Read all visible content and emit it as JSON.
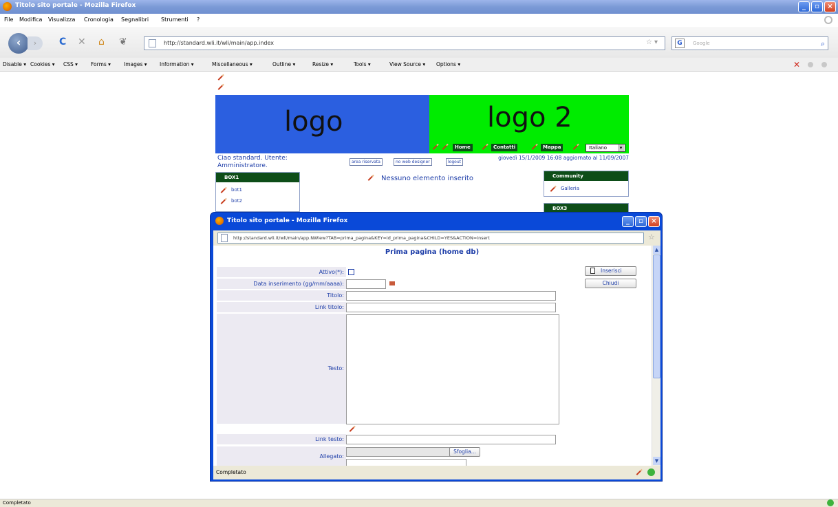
{
  "browser": {
    "window_title": "Titolo sito portale - Mozilla Firefox",
    "menu": [
      "File",
      "Modifica",
      "Visualizza",
      "Cronologia",
      "Segnalibri",
      "Strumenti",
      "?"
    ],
    "url": "http://standard.wli.it/wli/main/app.index",
    "search_placeholder": "Google",
    "search_engine_icon": "G",
    "devtools": [
      "Disable ▾",
      "Cookies ▾",
      "CSS ▾",
      "Forms ▾",
      "Images ▾",
      "Information ▾",
      "Miscellaneous ▾",
      "Outline ▾",
      "Resize ▾",
      "Tools ▾",
      "View Source ▾",
      "Options ▾"
    ],
    "status": "Completato"
  },
  "page": {
    "logo1": "logo",
    "logo2": "logo 2",
    "nav": [
      "Home",
      "Contatti",
      "Mappa"
    ],
    "language": "Italiano",
    "greeting": "Ciao standard. Utente: Amministratore.",
    "buttons": [
      "area riservata",
      "no web designer",
      "logout"
    ],
    "date": "giovedì 15/1/2009 16:08 aggiornato al 11/09/2007",
    "empty_msg": "Nessuno elemento inserito",
    "box1": {
      "title": "BOX1",
      "items": [
        "bot1",
        "bot2"
      ]
    },
    "community": {
      "title": "Community",
      "items": [
        "Galleria"
      ]
    },
    "box3": {
      "title": "BOX3"
    }
  },
  "popup": {
    "window_title": "Titolo sito portale - Mozilla Firefox",
    "url": "http://standard.wli.it/wli/main/app.NWiew?TAB=prima_pagina&KEY=id_prima_pagina&CHILD=YES&ACTION=insert",
    "form_title": "Prima pagina (home db)",
    "labels": {
      "attivo": "Attivo(*):",
      "data": "Data inserimento (gg/mm/aaaa):",
      "titolo": "Titolo:",
      "link_titolo": "Link titolo:",
      "testo": "Testo:",
      "link_testo": "Link testo:",
      "allegato": "Allegato:"
    },
    "insert_button": "Inserisci",
    "close_button": "Chiudi",
    "browse_button": "Sfoglia...",
    "status": "Completato"
  }
}
